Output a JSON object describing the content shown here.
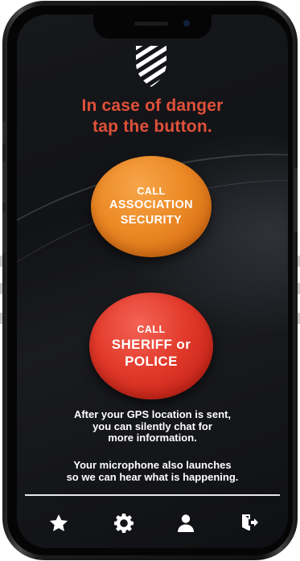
{
  "headline": {
    "line1": "In case of danger",
    "line2": "tap the button."
  },
  "buttons": {
    "association": {
      "line1": "CALL",
      "line2": "ASSOCIATION",
      "line3": "SECURITY"
    },
    "police": {
      "line1": "CALL",
      "line2": "SHERIFF or",
      "line3": "POLICE"
    }
  },
  "info": {
    "gps": {
      "line1": "After your GPS location is sent,",
      "line2": "you can silently chat for",
      "line3": "more information."
    },
    "microphone": {
      "line1": "Your microphone also launches",
      "line2": "so we can hear what is happening."
    }
  },
  "tabbar": {
    "items": [
      {
        "icon": "star-icon"
      },
      {
        "icon": "gear-icon"
      },
      {
        "icon": "user-icon"
      },
      {
        "icon": "logout-icon"
      }
    ]
  },
  "colors": {
    "headline": "#e0503a",
    "association_button": "#ec8a26",
    "police_button": "#e23a2b",
    "screen_background": "#15161a",
    "text": "#ffffff"
  }
}
